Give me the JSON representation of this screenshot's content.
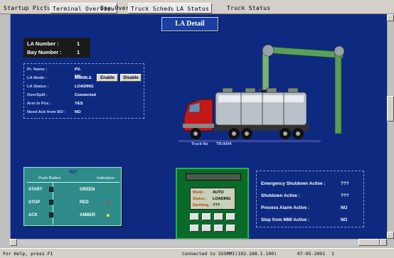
{
  "tabs": [
    "Startup Picture",
    "Terminal Overview",
    "Bay Overview",
    "Truck Schedule",
    "LA Status",
    "Truck Status"
  ],
  "title": "LA Detail",
  "la": {
    "number_label": "LA Number :",
    "number_value": "1",
    "bay_label": "Bay Number :",
    "bay_value": "1"
  },
  "info": {
    "rows": [
      {
        "label": "Pr. Name :",
        "value": "P2-MS"
      },
      {
        "label": "LA Mode :",
        "value": "ENABLE"
      },
      {
        "label": "LA Status :",
        "value": "LOADING"
      },
      {
        "label": "OverSpill :",
        "value": "Connected"
      },
      {
        "label": "Arm In Pos :",
        "value": "YES"
      },
      {
        "label": "Need Ack from BO :",
        "value": "NO"
      }
    ],
    "enable_label": "Enable",
    "disable_label": "Disable"
  },
  "truck": {
    "label": "Truck No",
    "number": "TR-0004"
  },
  "rit": {
    "title": "RIT",
    "push_header": "Push Button",
    "indication_header": "Indication",
    "rows": [
      {
        "button": "START",
        "indicator": "GREEN",
        "color": "#3a9a3a"
      },
      {
        "button": "STOP",
        "indicator": "RED",
        "color": "#c04040"
      },
      {
        "button": "ACK",
        "indicator": "AMBER",
        "color": "#f0e040"
      }
    ]
  },
  "console": {
    "mode_label": "Mode :",
    "mode_value": "AUTO",
    "status_label": "Status :",
    "status_value": "LOADING",
    "earthing_label": "Earthing :",
    "earthing_value": "???"
  },
  "status": {
    "rows": [
      {
        "label": "Emergency Shutdown Active :",
        "value": "???"
      },
      {
        "label": "Shutdown Active :",
        "value": "???"
      },
      {
        "label": "Process Alarm Active :",
        "value": "NO"
      },
      {
        "label": "Stop from MMI Active :",
        "value": "NO"
      }
    ]
  },
  "statusbar": {
    "help": "For Help, press F1",
    "connection": "Connected  to  SSSMMI(192.168.1.100)",
    "date": "07-05-2001",
    "page": "1"
  },
  "colors": {
    "background": "#0e2a80",
    "arm": "#5a9a5a",
    "truck_cab": "#c01818"
  }
}
